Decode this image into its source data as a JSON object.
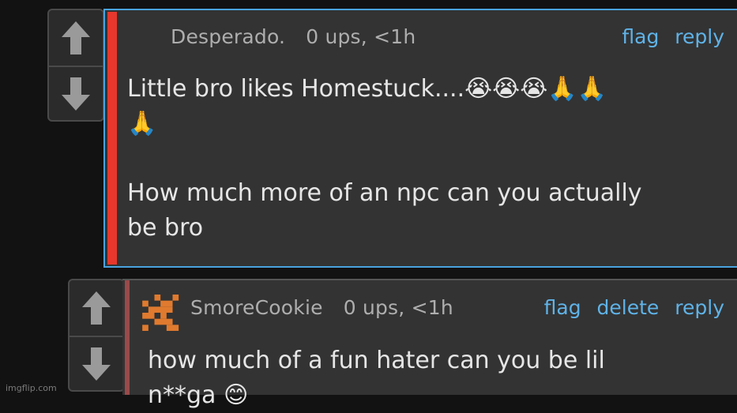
{
  "comments": [
    {
      "username": "Desperado.",
      "ups": "0 ups, <1h",
      "actions": [
        "flag",
        "reply"
      ],
      "text_line1": "Little bro likes Homestuck....😭😭😭🙏🙏",
      "text_line2": "🙏",
      "text_line3": "How much more of an npc can you actually",
      "text_line4": "be bro"
    },
    {
      "username": "SmoreCookie",
      "ups": "0 ups, <1h",
      "actions": [
        "flag",
        "delete",
        "reply"
      ],
      "text_line1": "how much of a fun hater can you be lil",
      "text_line2": "n**ga 😊"
    }
  ],
  "watermark": "imgflip.com",
  "colors": {
    "accent_link": "#5fb3e8",
    "op_bar": "#e8372c",
    "highlight_border": "#4aa3df"
  }
}
